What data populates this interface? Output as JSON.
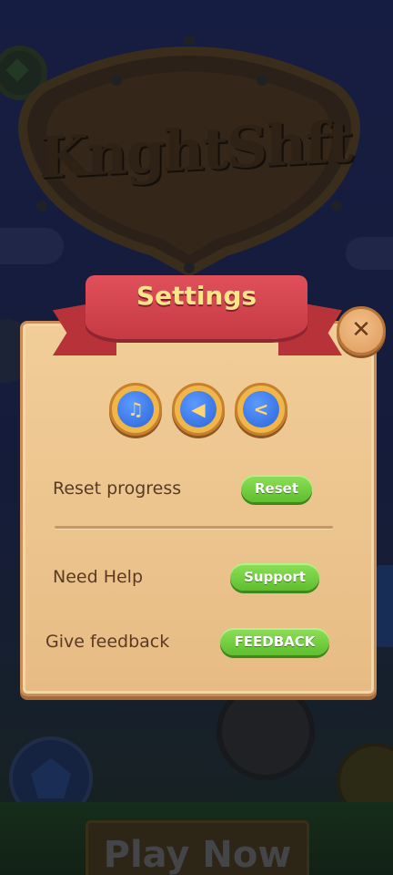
{
  "background": {
    "game_logo": "KnghtShft",
    "play_button_label": "Play Now"
  },
  "settings": {
    "title": "Settings",
    "close_symbol": "✕",
    "icons": [
      {
        "name": "music-note-icon",
        "glyph": "♫"
      },
      {
        "name": "sound-icon",
        "glyph": "◀"
      },
      {
        "name": "share-icon",
        "glyph": "<"
      }
    ],
    "rows": {
      "reset": {
        "label": "Reset progress",
        "button": "Reset"
      },
      "help": {
        "label": "Need Help",
        "button": "Support"
      },
      "feedback": {
        "label": "Give feedback",
        "button": "FEEDBACK"
      }
    }
  },
  "colors": {
    "panel": "#f1cd98",
    "ribbon": "#d8464f",
    "title_text": "#fbe58b",
    "green_button": "#6fcd3c",
    "label_text": "#5b3a24"
  }
}
